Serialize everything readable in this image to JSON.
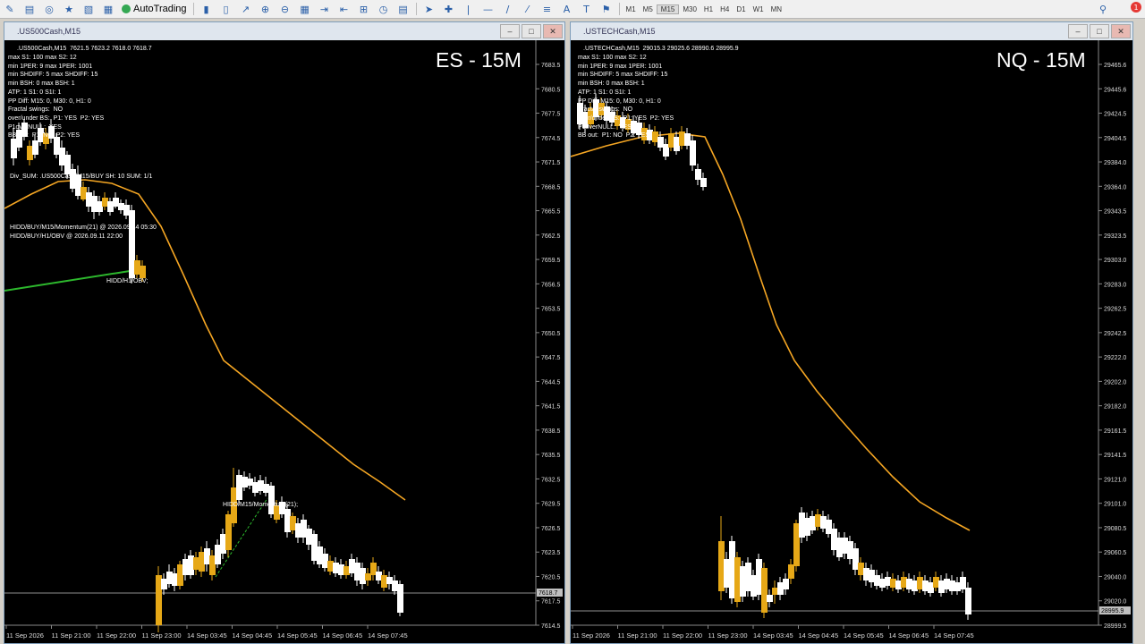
{
  "toolbar": {
    "autotrading_label": "AutoTrading",
    "timeframes": [
      "M1",
      "M5",
      "M15",
      "M30",
      "H1",
      "H4",
      "D1",
      "W1",
      "MN"
    ],
    "active_timeframe": "M15",
    "notification_count": "1"
  },
  "colors": {
    "bull_candle": "#ffffff",
    "bear_candle": "#e6a817",
    "ma_line": "#f5a623",
    "div_line": "#2db82d",
    "bid_line": "#c0c0c0"
  },
  "left": {
    "title": ".US500Cash,M15",
    "header": ".US500Cash,M15  7621.5 7623.2 7618.0 7618.7",
    "label": "ES - 15M",
    "info": [
      "max S1: 100 max S2: 12",
      "min 1PER: 9 max 1PER: 1001",
      "min SHDIFF: 5 max SHDIFF: 15",
      "min BSH: 0 max BSH: 1",
      "ATP: 1 S1: 0 S1I: 1",
      "PP Diff: M15: 0, M30: 0, H1: 0",
      "Fractal swings:  NO",
      "over/under BS:  P1: YES  P2: YES",
      "P1overNULL:  YES",
      "BB out:  P1: NO  P2: YES"
    ],
    "div_sum": "Div_SUM: .US500Cash/M15/BUY SH: 10 SUM: 1/1",
    "hidd1": "HIDD/BUY/M15/Momentum(21) @ 2026.09.14 05:30",
    "hidd2": "HIDD/BUY/H1/OBV @ 2026.09.11 22:00",
    "hidd_obv": "HIDD/H1/OBV;",
    "hidd_mom": "HIDD/M15/Momentum(21);",
    "prices": [
      "7683.5",
      "7680.5",
      "7677.5",
      "7674.5",
      "7671.5",
      "7668.5",
      "7665.5",
      "7662.5",
      "7659.5",
      "7656.5",
      "7653.5",
      "7650.5",
      "7647.5",
      "7644.5",
      "7641.5",
      "7638.5",
      "7635.5",
      "7632.5",
      "7629.5",
      "7626.5",
      "7623.5",
      "7620.5",
      "7617.5",
      "7614.5"
    ],
    "current_price": "7618.7",
    "dates": [
      "11 Sep 2026",
      "11 Sep 21:00",
      "11 Sep 22:00",
      "11 Sep 23:00",
      "14 Sep 03:45",
      "14 Sep 04:45",
      "14 Sep 05:45",
      "14 Sep 06:45",
      "14 Sep 07:45"
    ]
  },
  "right": {
    "title": ".USTECHCash,M15",
    "header": ".USTECHCash,M15  29015.3 29025.6 28990.6 28995.9",
    "label": "NQ - 15M",
    "info": [
      "max S1: 100 max S2: 12",
      "min 1PER: 9 max 1PER: 1001",
      "min SHDIFF: 5 max SHDIFF: 15",
      "min BSH: 0 max BSH: 1",
      "ATP: 1 S1: 0 S1I: 1",
      "PP Diff: M15: 0, M30: 0, H1: 0",
      "Fractal swings:  NO",
      "over/under BS:  P1: YES  P2: YES",
      "P1overNULL:  YES",
      "BB out:  P1: NO  P2: YES"
    ],
    "prices": [
      "29465.6",
      "29445.6",
      "29424.5",
      "29404.5",
      "29384.0",
      "29364.0",
      "29343.5",
      "29323.5",
      "29303.0",
      "29283.0",
      "29262.5",
      "29242.5",
      "29222.0",
      "29202.0",
      "29182.0",
      "29161.5",
      "29141.5",
      "29121.0",
      "29101.0",
      "29080.5",
      "29060.5",
      "29040.0",
      "29020.0",
      "28999.5"
    ],
    "current_price": "28995.9",
    "dates": [
      "11 Sep 2026",
      "11 Sep 21:00",
      "11 Sep 22:00",
      "11 Sep 23:00",
      "14 Sep 03:45",
      "14 Sep 04:45",
      "14 Sep 05:45",
      "14 Sep 06:45",
      "14 Sep 07:45"
    ]
  }
}
